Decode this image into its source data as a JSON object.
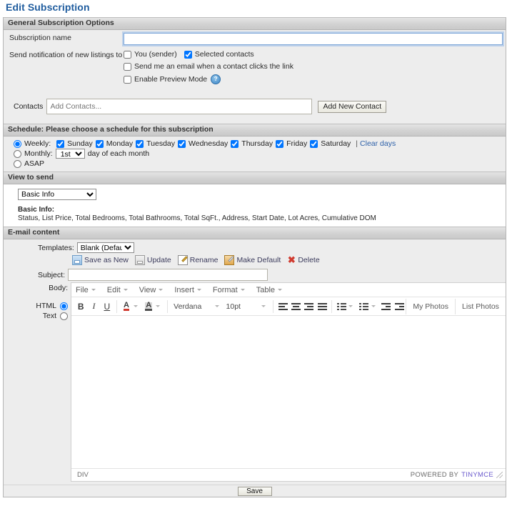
{
  "page": {
    "title": "Edit Subscription"
  },
  "general": {
    "header": "General Subscription Options",
    "subscription_name_label": "Subscription name",
    "subscription_name_value": "",
    "notify_label": "Send notification of new listings to",
    "opt_you_sender": "You (sender)",
    "opt_selected_contacts": "Selected contacts",
    "opt_email_on_click": "Send me an email when a contact clicks the link",
    "opt_preview_mode": "Enable Preview Mode",
    "help_icon_text": "?",
    "checked": {
      "you_sender": false,
      "selected_contacts": true,
      "email_on_click": false,
      "preview_mode": false
    }
  },
  "contacts": {
    "label": "Contacts",
    "placeholder": "Add Contacts...",
    "value": "",
    "add_button": "Add New Contact"
  },
  "schedule": {
    "header": "Schedule: Please choose a schedule for this subscription",
    "weekly_label": "Weekly:",
    "days": [
      {
        "label": "Sunday",
        "checked": true
      },
      {
        "label": "Monday",
        "checked": true
      },
      {
        "label": "Tuesday",
        "checked": true
      },
      {
        "label": "Wednesday",
        "checked": true
      },
      {
        "label": "Thursday",
        "checked": true
      },
      {
        "label": "Friday",
        "checked": true
      },
      {
        "label": "Saturday",
        "checked": true
      }
    ],
    "separator": "|",
    "clear_days": "Clear days",
    "monthly_label": "Monthly:",
    "monthly_value": "1st",
    "monthly_suffix": "day of each month",
    "asap_label": "ASAP",
    "selected_mode": "weekly"
  },
  "view_to_send": {
    "header": "View to send",
    "selected": "Basic Info",
    "options": [
      "Basic Info"
    ],
    "detail_title": "Basic Info:",
    "detail_fields": "Status, List Price, Total Bedrooms, Total Bathrooms, Total SqFt., Address, Start Date, Lot Acres, Cumulative DOM"
  },
  "email_content": {
    "header": "E-mail content",
    "templates_label": "Templates:",
    "template_selected": "Blank (Default)",
    "actions": [
      {
        "label": "Save as New",
        "icon": "save-icon"
      },
      {
        "label": "Update",
        "icon": "disk-icon"
      },
      {
        "label": "Rename",
        "icon": "page-pencil-icon"
      },
      {
        "label": "Make Default",
        "icon": "clipboard-pencil-icon"
      },
      {
        "label": "Delete",
        "icon": "red-x-icon"
      }
    ],
    "subject_label": "Subject:",
    "subject_value": "",
    "body_label": "Body:",
    "mode_html": "HTML",
    "mode_text": "Text",
    "mode_selected": "HTML"
  },
  "editor": {
    "menus": [
      "File",
      "Edit",
      "View",
      "Insert",
      "Format",
      "Table"
    ],
    "bold": "B",
    "italic": "I",
    "underline": "U",
    "text_color_glyph": "A",
    "bg_color_glyph": "A",
    "font_family": "Verdana",
    "font_size": "10pt",
    "buttons": [
      "My Photos",
      "List Photos"
    ],
    "status_element": "DIV",
    "powered_by": "POWERED BY",
    "powered_brand": "TINYMCE",
    "content": ""
  },
  "footer": {
    "save_label": "Save"
  },
  "colors": {
    "title": "#1F5C9E",
    "link": "#2B5FA8",
    "section_bar": "#D2D2D2",
    "panel": "#EDEDED",
    "focus_border": "#7EA7D8",
    "delete_icon": "#D03A2F",
    "tinymce": "#6A5ACD"
  }
}
